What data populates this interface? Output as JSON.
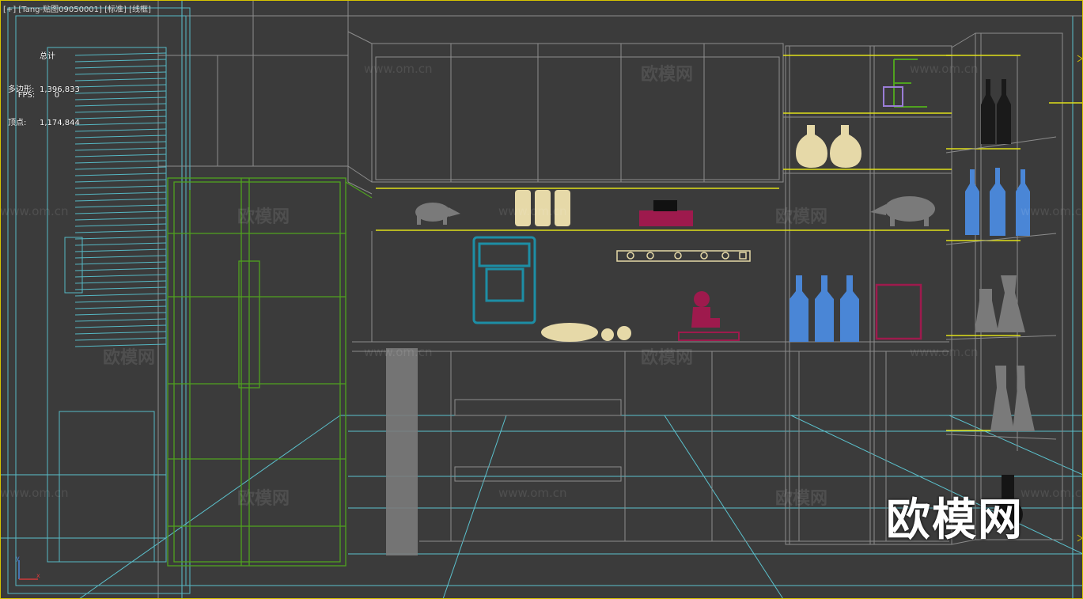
{
  "viewport": {
    "label": "[+] [Tang-贴图09050001] [标准] [线框]"
  },
  "stats": {
    "header": "总计",
    "polygons_label": "多边形:",
    "polygons_value": "1,396,833",
    "vertices_label": "顶点:",
    "vertices_value": "1,174,844",
    "fps_label": "FPS:",
    "fps_value": "0"
  },
  "watermark": {
    "text": "欧模网",
    "url": "www.om.cn",
    "big_text": "欧模网"
  },
  "colors": {
    "background": "#3b3b3b",
    "wire_gray": "#8c8c8c",
    "wire_cyan": "#5fd0dd",
    "window_cyan": "#56b8c4",
    "fridge_green": "#4fa21f",
    "shelf_yellow": "#e0e01a",
    "cream": "#e6d9a8",
    "blue_bottle": "#4a86d6",
    "gray_solid": "#7a7a7a",
    "magenta": "#9e1a4d",
    "teal_dispenser": "#1d8ea5",
    "frame_yellow": "#d6c400"
  },
  "axis": {
    "x": "x",
    "y": "y"
  }
}
